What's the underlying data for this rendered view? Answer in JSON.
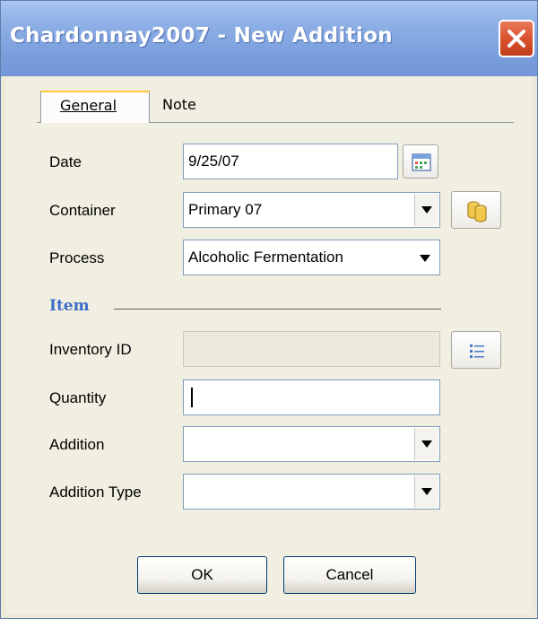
{
  "window": {
    "title": "Chardonnay2007 - New Addition"
  },
  "tabs": [
    {
      "label": "General",
      "active": true
    },
    {
      "label": "Note",
      "active": false
    }
  ],
  "form": {
    "date": {
      "label": "Date",
      "value": "9/25/07"
    },
    "container": {
      "label": "Container",
      "value": "Primary 07"
    },
    "process": {
      "label": "Process",
      "value": "Alcoholic Fermentation"
    }
  },
  "item_section": {
    "title": "Item",
    "inventory_id": {
      "label": "Inventory ID",
      "value": ""
    },
    "quantity": {
      "label": "Quantity",
      "value": ""
    },
    "addition": {
      "label": "Addition",
      "value": ""
    },
    "addition_type": {
      "label": "Addition Type",
      "value": ""
    }
  },
  "buttons": {
    "ok": "OK",
    "cancel": "Cancel"
  },
  "icons": {
    "close": "close-icon",
    "calendar": "calendar-icon",
    "containers": "containers-icon",
    "list": "list-icon"
  },
  "colors": {
    "section_title": "#3a6cc6",
    "close_button": "#d8532e",
    "tab_highlight": "#ffc83c"
  }
}
